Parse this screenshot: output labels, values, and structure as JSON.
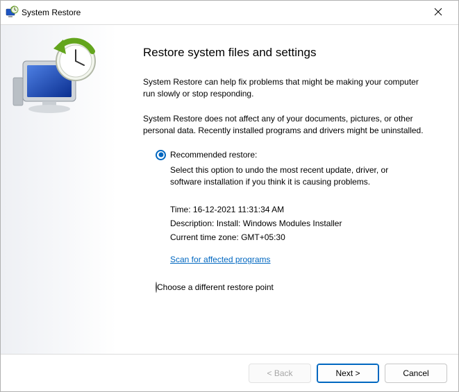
{
  "titlebar": {
    "title": "System Restore"
  },
  "page": {
    "heading": "Restore system files and settings",
    "intro1": "System Restore can help fix problems that might be making your computer run slowly or stop responding.",
    "intro2": "System Restore does not affect any of your documents, pictures, or other personal data. Recently installed programs and drivers might be uninstalled."
  },
  "option_recommended": {
    "label": "Recommended restore:",
    "description": "Select this option to undo the most recent update, driver, or software installation if you think it is causing problems.",
    "time_label": "Time:",
    "time_value": "16-12-2021 11:31:34 AM",
    "desc_label": "Description:",
    "desc_value": "Install: Windows Modules Installer",
    "tz_label": "Current time zone:",
    "tz_value": "GMT+05:30",
    "scan_link": "Scan for affected programs"
  },
  "option_different": {
    "label": "Choose a different restore point"
  },
  "footer": {
    "back": "< Back",
    "next": "Next >",
    "cancel": "Cancel"
  }
}
